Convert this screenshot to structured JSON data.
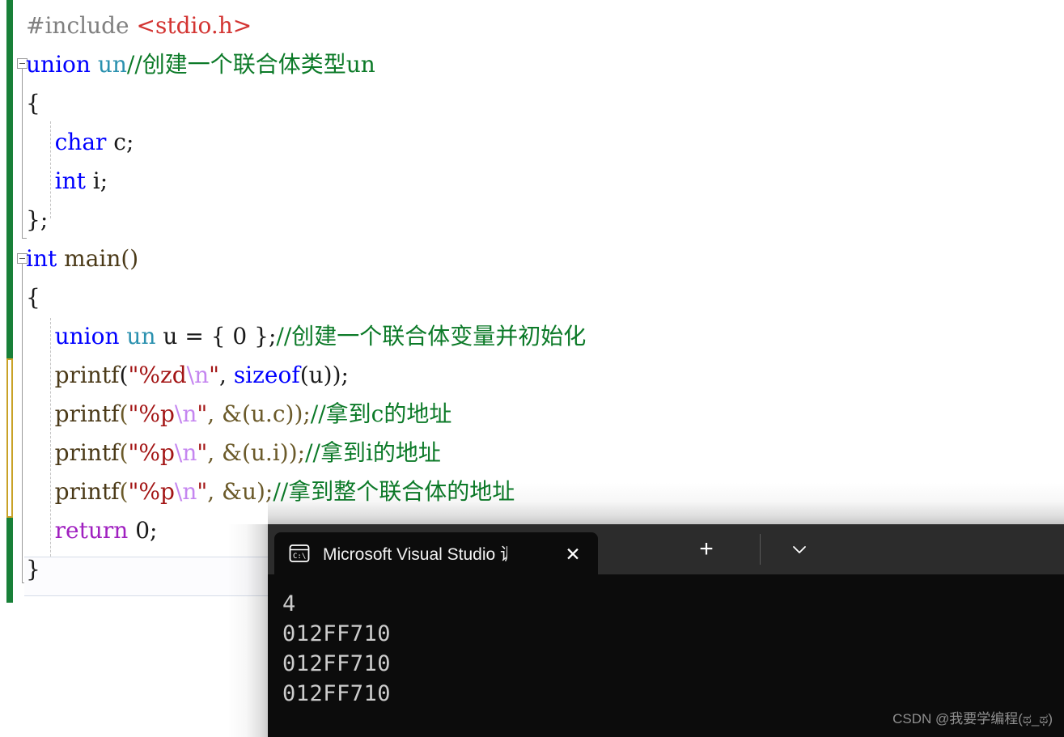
{
  "editor": {
    "name": "Visual Studio code editor",
    "lines": [
      {
        "indent": 0,
        "tokens": [
          {
            "t": "#include ",
            "c": "pre"
          },
          {
            "t": "<stdio.h>",
            "c": "inc"
          }
        ]
      },
      {
        "indent": 0,
        "tokens": [
          {
            "t": "union ",
            "c": "kw"
          },
          {
            "t": "un",
            "c": "type"
          },
          {
            "t": "//创建一个联合体类型un",
            "c": "comment"
          }
        ]
      },
      {
        "indent": 0,
        "tokens": [
          {
            "t": "{",
            "c": "plain"
          }
        ]
      },
      {
        "indent": 0,
        "tokens": [
          {
            "t": "    ",
            "c": "plain"
          },
          {
            "t": "char",
            "c": "kw"
          },
          {
            "t": " c;",
            "c": "plain"
          }
        ]
      },
      {
        "indent": 0,
        "tokens": [
          {
            "t": "    ",
            "c": "plain"
          },
          {
            "t": "int",
            "c": "kw"
          },
          {
            "t": " i;",
            "c": "plain"
          }
        ]
      },
      {
        "indent": 0,
        "tokens": [
          {
            "t": "};",
            "c": "plain"
          }
        ]
      },
      {
        "indent": 0,
        "tokens": [
          {
            "t": "int",
            "c": "kw"
          },
          {
            "t": " main()",
            "c": "fn"
          }
        ]
      },
      {
        "indent": 0,
        "tokens": [
          {
            "t": "{",
            "c": "plain"
          }
        ]
      },
      {
        "indent": 0,
        "tokens": [
          {
            "t": "    ",
            "c": "plain"
          },
          {
            "t": "union ",
            "c": "kw"
          },
          {
            "t": "un",
            "c": "type"
          },
          {
            "t": " u = { ",
            "c": "plain"
          },
          {
            "t": "0",
            "c": "num"
          },
          {
            "t": " };",
            "c": "plain"
          },
          {
            "t": "//创建一个联合体变量并初始化",
            "c": "comment"
          }
        ]
      },
      {
        "indent": 0,
        "tokens": [
          {
            "t": "    ",
            "c": "plain"
          },
          {
            "t": "printf",
            "c": "fn"
          },
          {
            "t": "(",
            "c": "plain"
          },
          {
            "t": "\"%zd",
            "c": "str"
          },
          {
            "t": "\\n",
            "c": "esc"
          },
          {
            "t": "\"",
            "c": "str"
          },
          {
            "t": ", ",
            "c": "plain"
          },
          {
            "t": "sizeof",
            "c": "kw"
          },
          {
            "t": "(u));",
            "c": "plain"
          }
        ]
      },
      {
        "indent": 0,
        "tokens": [
          {
            "t": "    ",
            "c": "plain"
          },
          {
            "t": "printf",
            "c": "fn"
          },
          {
            "t": "(",
            "c": "plain-b"
          },
          {
            "t": "\"%p",
            "c": "str"
          },
          {
            "t": "\\n",
            "c": "esc"
          },
          {
            "t": "\"",
            "c": "str"
          },
          {
            "t": ", &(u.c));",
            "c": "plain-b"
          },
          {
            "t": "//拿到c的地址",
            "c": "comment"
          }
        ]
      },
      {
        "indent": 0,
        "tokens": [
          {
            "t": "    ",
            "c": "plain"
          },
          {
            "t": "printf",
            "c": "fn"
          },
          {
            "t": "(",
            "c": "plain-b"
          },
          {
            "t": "\"%p",
            "c": "str"
          },
          {
            "t": "\\n",
            "c": "esc"
          },
          {
            "t": "\"",
            "c": "str"
          },
          {
            "t": ", &(u.i));",
            "c": "plain-b"
          },
          {
            "t": "//拿到i的地址",
            "c": "comment"
          }
        ]
      },
      {
        "indent": 0,
        "tokens": [
          {
            "t": "    ",
            "c": "plain"
          },
          {
            "t": "printf",
            "c": "fn"
          },
          {
            "t": "(",
            "c": "plain-b"
          },
          {
            "t": "\"%p",
            "c": "str"
          },
          {
            "t": "\\n",
            "c": "esc"
          },
          {
            "t": "\"",
            "c": "str"
          },
          {
            "t": ", &u);",
            "c": "plain-b"
          },
          {
            "t": "//拿到整个联合体的地址",
            "c": "comment"
          }
        ]
      },
      {
        "indent": 0,
        "tokens": [
          {
            "t": "    ",
            "c": "plain"
          },
          {
            "t": "return",
            "c": "ctrl"
          },
          {
            "t": " ",
            "c": "plain"
          },
          {
            "t": "0",
            "c": "num"
          },
          {
            "t": ";",
            "c": "plain"
          }
        ]
      },
      {
        "indent": 0,
        "tokens": [
          {
            "t": "}",
            "c": "plain"
          }
        ]
      }
    ],
    "colors": {
      "preprocessor": "#808080",
      "include_path": "#d33432",
      "keyword": "#0000ff",
      "type": "#2b91af",
      "comment": "#0c7a28",
      "string": "#a31515",
      "escape": "#c586f0",
      "control_keyword": "#a020c0",
      "plain": "#1a1a1a",
      "change_saved_bar": "#188038",
      "change_unsaved_bar": "#c9a227"
    }
  },
  "terminal": {
    "tab_title": "Microsoft Visual Studio 调试控",
    "tab_icon": "console-icon",
    "close_label": "✕",
    "new_tab_label": "+",
    "dropdown_label": "chevron-down-icon",
    "output": [
      "4",
      "012FF710",
      "012FF710",
      "012FF710"
    ],
    "colors": {
      "titlebar": "#2c2c2c",
      "body": "#0c0c0c",
      "text": "#cccccc"
    }
  },
  "watermark": {
    "text": "CSDN @我要学编程(ಥ_ಥ)"
  }
}
